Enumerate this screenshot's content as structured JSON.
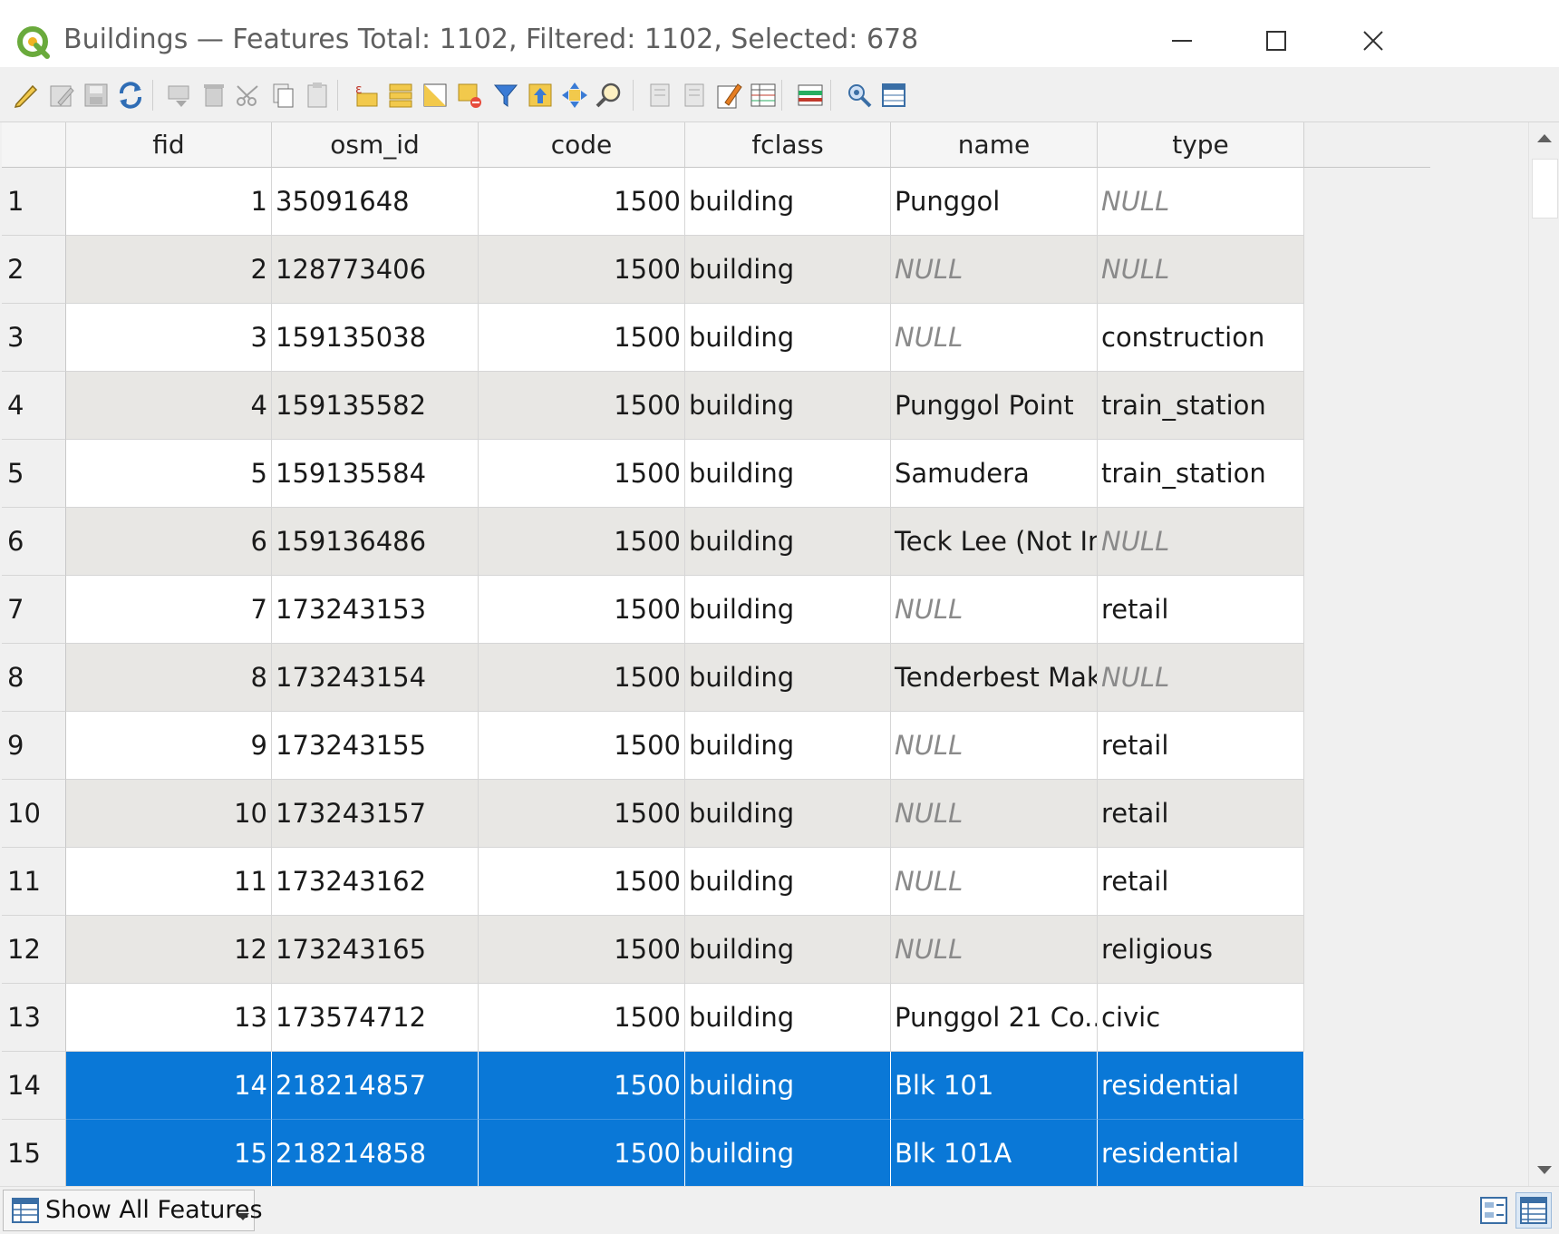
{
  "window": {
    "title": "Buildings — Features Total: 1102, Filtered: 1102, Selected: 678"
  },
  "toolbar": {
    "icons": [
      "toggle-editing-icon",
      "multi-edit-icon",
      "save-edits-icon",
      "reload-icon",
      "add-feature-icon",
      "delete-feature-icon",
      "cut-icon",
      "copy-icon",
      "paste-icon",
      "select-expression-icon",
      "select-all-icon",
      "invert-selection-icon",
      "deselect-all-icon",
      "filter-select-icon",
      "move-selection-top-icon",
      "pan-to-selection-icon",
      "zoom-to-selection-icon",
      "new-field-icon",
      "delete-field-icon",
      "field-calculator-icon",
      "conditional-formatting-icon",
      "organize-columns-icon",
      "actions-icon",
      "dock-table-icon"
    ]
  },
  "table": {
    "columns": [
      "fid",
      "osm_id",
      "code",
      "fclass",
      "name",
      "type"
    ],
    "rows": [
      {
        "n": "1",
        "fid": "1",
        "osm_id": "35091648",
        "code": "1500",
        "fclass": "building",
        "name": "Punggol",
        "type": "NULL"
      },
      {
        "n": "2",
        "fid": "2",
        "osm_id": "128773406",
        "code": "1500",
        "fclass": "building",
        "name": "NULL",
        "type": "NULL"
      },
      {
        "n": "3",
        "fid": "3",
        "osm_id": "159135038",
        "code": "1500",
        "fclass": "building",
        "name": "NULL",
        "type": "construction"
      },
      {
        "n": "4",
        "fid": "4",
        "osm_id": "159135582",
        "code": "1500",
        "fclass": "building",
        "name": "Punggol Point",
        "type": "train_station"
      },
      {
        "n": "5",
        "fid": "5",
        "osm_id": "159135584",
        "code": "1500",
        "fclass": "building",
        "name": "Samudera",
        "type": "train_station"
      },
      {
        "n": "6",
        "fid": "6",
        "osm_id": "159136486",
        "code": "1500",
        "fclass": "building",
        "name": "Teck Lee (Not In ...",
        "type": "NULL"
      },
      {
        "n": "7",
        "fid": "7",
        "osm_id": "173243153",
        "code": "1500",
        "fclass": "building",
        "name": "NULL",
        "type": "retail"
      },
      {
        "n": "8",
        "fid": "8",
        "osm_id": "173243154",
        "code": "1500",
        "fclass": "building",
        "name": "Tenderbest Mak...",
        "type": "NULL"
      },
      {
        "n": "9",
        "fid": "9",
        "osm_id": "173243155",
        "code": "1500",
        "fclass": "building",
        "name": "NULL",
        "type": "retail"
      },
      {
        "n": "10",
        "fid": "10",
        "osm_id": "173243157",
        "code": "1500",
        "fclass": "building",
        "name": "NULL",
        "type": "retail"
      },
      {
        "n": "11",
        "fid": "11",
        "osm_id": "173243162",
        "code": "1500",
        "fclass": "building",
        "name": "NULL",
        "type": "retail"
      },
      {
        "n": "12",
        "fid": "12",
        "osm_id": "173243165",
        "code": "1500",
        "fclass": "building",
        "name": "NULL",
        "type": "religious"
      },
      {
        "n": "13",
        "fid": "13",
        "osm_id": "173574712",
        "code": "1500",
        "fclass": "building",
        "name": "Punggol 21 Co...",
        "type": "civic"
      },
      {
        "n": "14",
        "fid": "14",
        "osm_id": "218214857",
        "code": "1500",
        "fclass": "building",
        "name": "Blk 101",
        "type": "residential",
        "selected": true
      },
      {
        "n": "15",
        "fid": "15",
        "osm_id": "218214858",
        "code": "1500",
        "fclass": "building",
        "name": "Blk 101A",
        "type": "residential",
        "selected": true
      }
    ],
    "selection_color": "#0a78d7",
    "null_token": "NULL"
  },
  "status": {
    "filter_label": "Show All Features",
    "view_buttons": [
      "form-view-icon",
      "table-view-icon"
    ]
  }
}
